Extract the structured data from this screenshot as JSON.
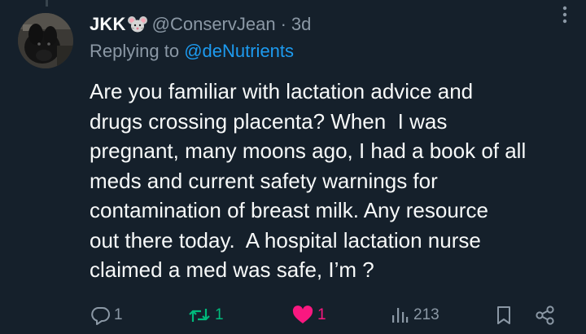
{
  "author": {
    "display_name": "JKK",
    "emoji_icon": "mouse-face-icon",
    "handle": "@ConservJean",
    "separator": "·",
    "age": "3d"
  },
  "reply": {
    "prefix": "Replying to ",
    "mention": "@deNutrients"
  },
  "body": "Are you familiar with lactation advice and\ndrugs crossing placenta? When  I was\npregnant, many moons ago, I had a book of all\nmeds and current safety warnings for\ncontamination of breast milk. Any resource\nout there today.  A hospital lactation nurse\nclaimed a med was safe, I’m ?",
  "actions": {
    "reply_count": "1",
    "retweet_count": "1",
    "like_count": "1",
    "view_count": "213",
    "liked": true,
    "retweeted": true
  },
  "colors": {
    "background": "#15202b",
    "text_primary": "#f7f9f9",
    "text_secondary": "#8b98a5",
    "link": "#1d9bf0",
    "retweet": "#00ba7c",
    "like": "#f91880"
  }
}
